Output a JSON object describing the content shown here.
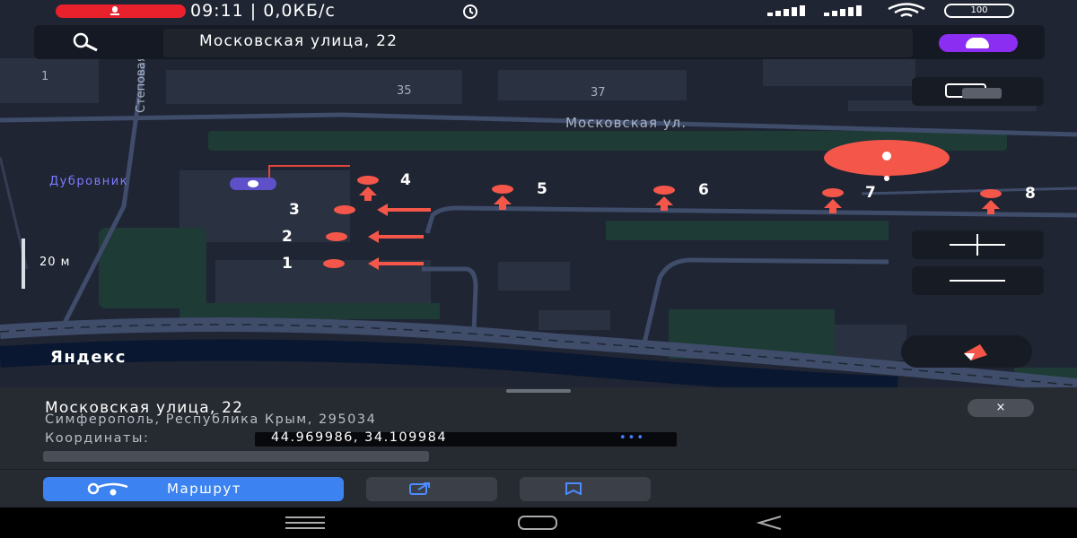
{
  "status_bar": {
    "time_speed": "09:11 | 0,0КБ/с",
    "battery": "100"
  },
  "search": {
    "query": "Московская улица, 22"
  },
  "map": {
    "street_main": "Московская ул.",
    "street_side": "Степовая ул.",
    "house_numbers": [
      "1",
      "35",
      "37"
    ],
    "poi_name": "Дубровник",
    "scale": "20 м",
    "logo": "Яндекс",
    "markers": [
      "1",
      "2",
      "3",
      "4",
      "5",
      "6",
      "7",
      "8"
    ],
    "colors": {
      "map_bg": "#1f2533",
      "road": "#3d4a66",
      "marker_red": "#f4574a",
      "poi_purple": "#5d50c8"
    }
  },
  "place": {
    "title": "Московская улица, 22",
    "address": "Симферополь, Республика Крым, 295034",
    "coords_label": "Координаты:",
    "coords_value": "44.969986, 34.109984",
    "coords_more": "•••",
    "close": "×"
  },
  "actions": {
    "route_label": "Маршрут",
    "share_icon": "share-icon",
    "bookmark_icon": "bookmark-icon",
    "route_color": "#3c82f0"
  },
  "nav": {
    "items": [
      "menu-icon",
      "home-icon",
      "back-icon"
    ]
  }
}
